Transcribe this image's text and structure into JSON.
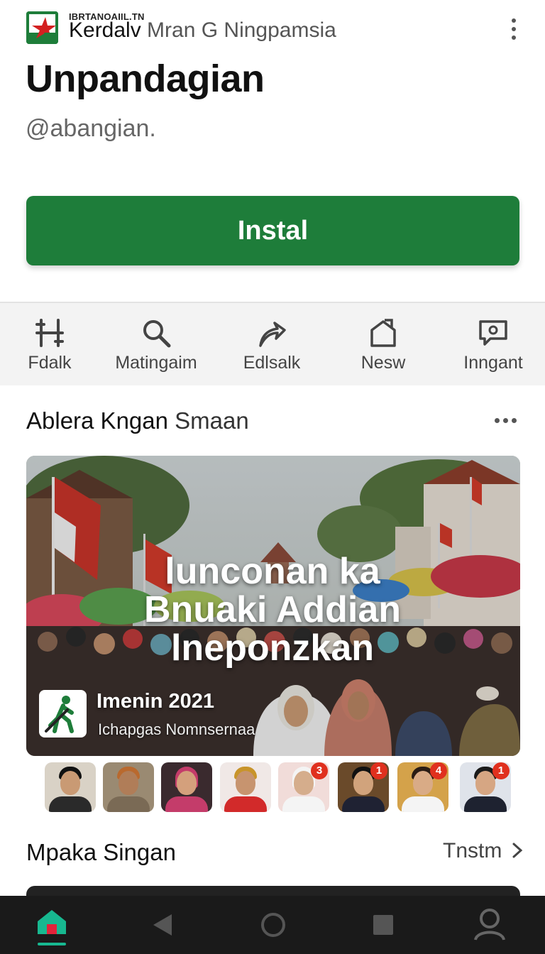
{
  "header": {
    "small_caps": "IBRTANOAIIL.TN",
    "developer_strong": "Kerdalv",
    "developer_rest": " Mran G Ningpamsia",
    "title": "Unpandagian",
    "handle": "@abangian.",
    "install_label": "Instal"
  },
  "actions": [
    {
      "label": "Fdalk",
      "icon": "hashtag-icon"
    },
    {
      "label": "Matingaim",
      "icon": "search-icon"
    },
    {
      "label": "Edlsalk",
      "icon": "share-arrow-icon"
    },
    {
      "label": "Nesw",
      "icon": "house-outline-icon"
    },
    {
      "label": "Inngant",
      "icon": "message-icon"
    }
  ],
  "section1": {
    "title_strong": "Ablera Kngan",
    "title_light": " Smaan"
  },
  "banner": {
    "headline": [
      "lunconan ka",
      "Bnuaki Addian",
      "lneponzkan"
    ],
    "year_text": "Imenin 2021",
    "subtitle": "Ichapgas Nomnsernaa"
  },
  "avatars": [
    {
      "badge": ""
    },
    {
      "badge": ""
    },
    {
      "badge": ""
    },
    {
      "badge": ""
    },
    {
      "badge": "3"
    },
    {
      "badge": "1"
    },
    {
      "badge": "4"
    },
    {
      "badge": "1"
    }
  ],
  "section2": {
    "title": "Mpaka Singan",
    "link": "Tnstm"
  },
  "colors": {
    "accent": "#1e7d3a",
    "badge": "#e0301e",
    "nav_bg": "#1a1a1a"
  }
}
